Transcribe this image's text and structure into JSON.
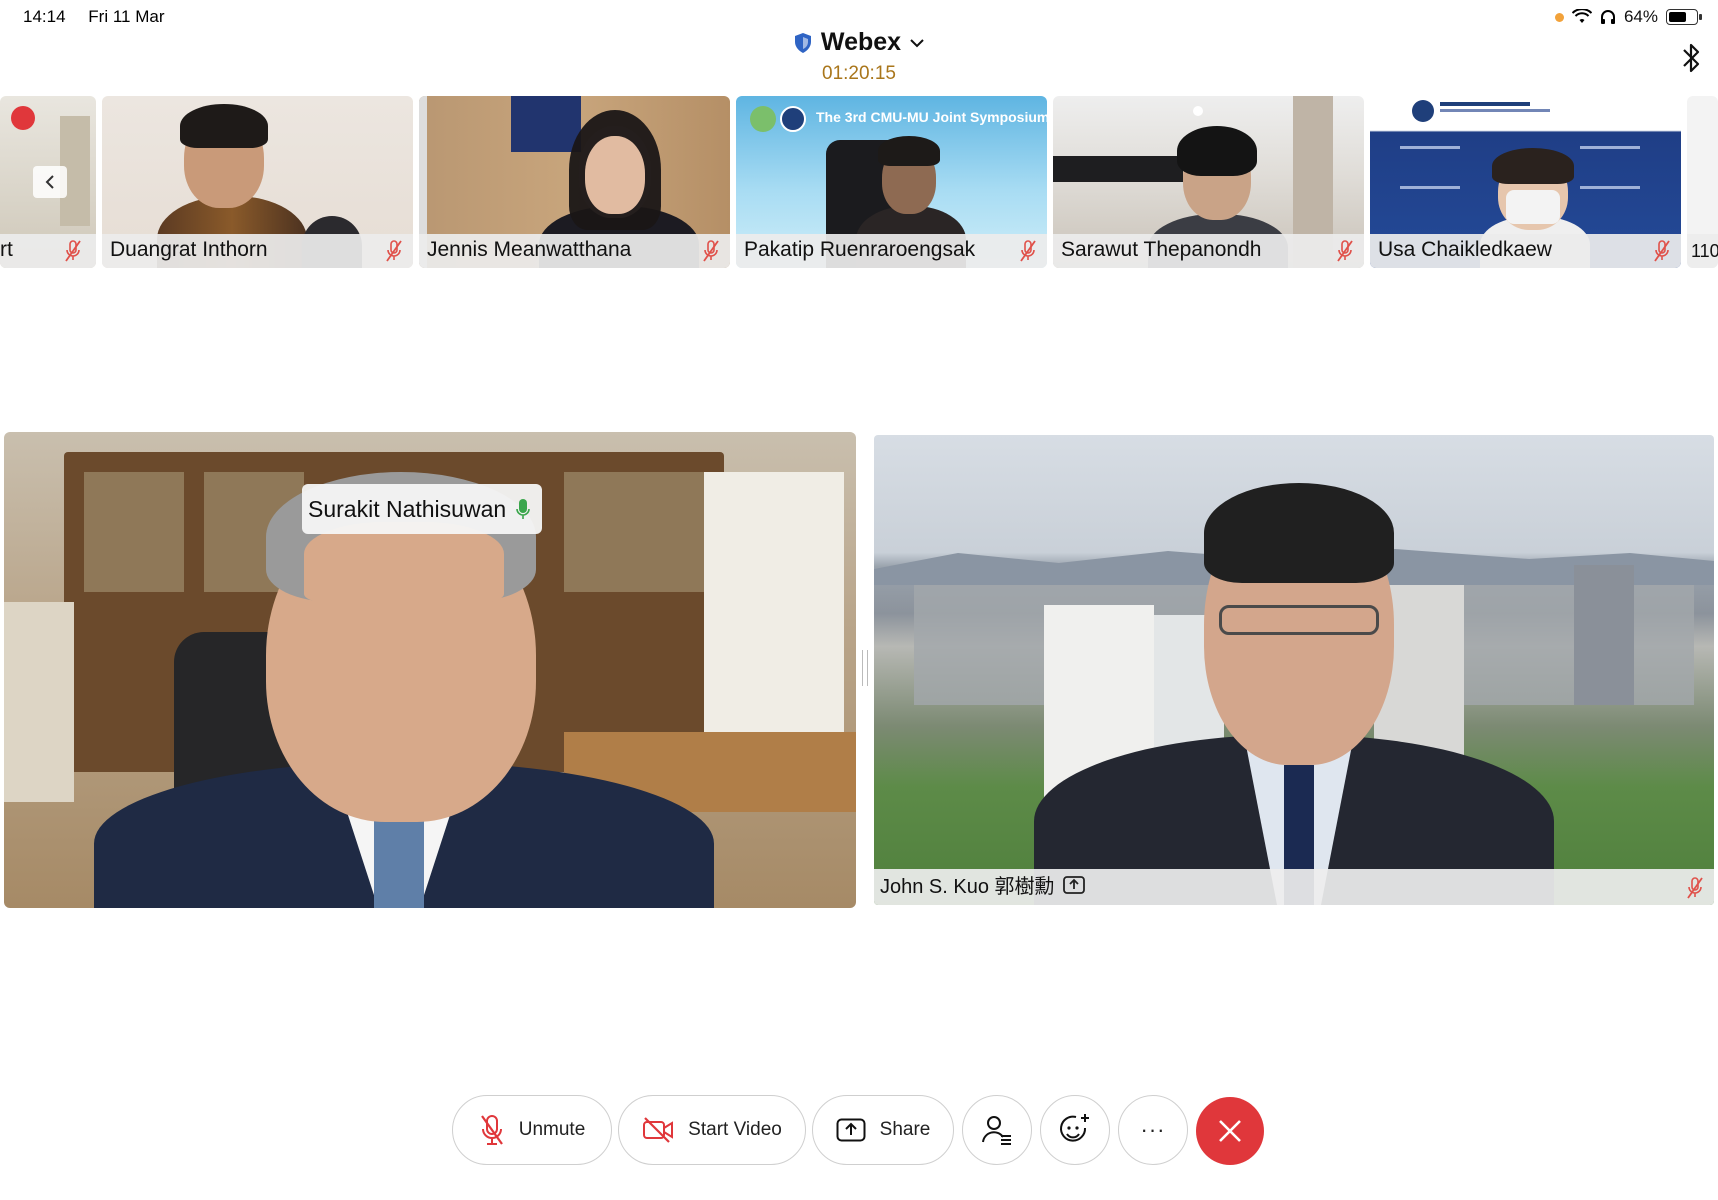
{
  "status": {
    "time": "14:14",
    "date": "Fri 11 Mar",
    "battery": "64%",
    "battery_level": 0.64
  },
  "header": {
    "app_name": "Webex",
    "timer": "01:20:15"
  },
  "filmstrip": {
    "partial_left_name": "rt",
    "tiles": [
      {
        "name": "Duangrat Inthorn"
      },
      {
        "name": "Jennis Meanwatthana"
      },
      {
        "name": "Pakatip Ruenraroengsak"
      },
      {
        "name": "Sarawut Thepanondh"
      },
      {
        "name": "Usa Chaikledkaew"
      }
    ],
    "partial_right_count": "110",
    "slide_banner": "The 3rd CMU-MU Joint Symposium"
  },
  "main": {
    "active_speaker": "Surakit Nathisuwan",
    "presenter": "John S. Kuo 郭樹勳"
  },
  "toolbar": {
    "unmute_label": "Unmute",
    "start_video_label": "Start Video",
    "share_label": "Share",
    "more_label": "···"
  },
  "colors": {
    "leave": "#e0373b",
    "timer": "#a9761b",
    "mic_muted": "#e0514a",
    "mic_active": "#3aa64c"
  }
}
